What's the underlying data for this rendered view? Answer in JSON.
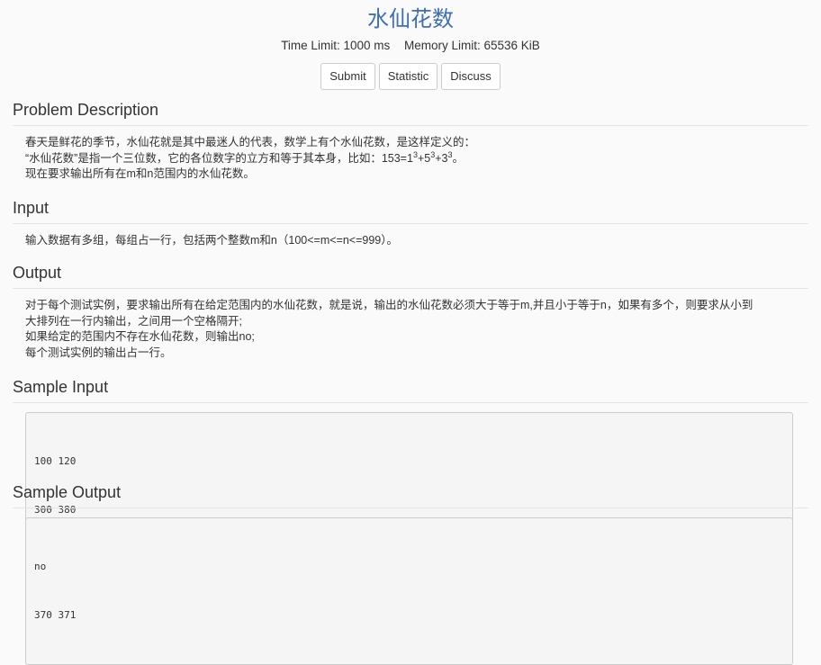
{
  "header": {
    "title": "水仙花数",
    "time_limit": "Time Limit: 1000 ms",
    "memory_limit": "Memory Limit: 65536 KiB",
    "buttons": [
      "Submit",
      "Statistic",
      "Discuss"
    ]
  },
  "description": {
    "title": "Problem Description",
    "line1": "春天是鲜花的季节，水仙花就是其中最迷人的代表，数学上有个水仙花数，是这样定义的：",
    "line2_text": "“水仙花数”是指一个三位数，它的各位数字的立方和等于其本身，比如：",
    "formula": {
      "prefix": "153=1",
      "exp1": "3",
      "plus1": "+5",
      "exp2": "3",
      "plus2": "+3",
      "exp3": "3",
      "end": "。"
    },
    "line3": "现在要求输出所有在m和n范围内的水仙花数。"
  },
  "input": {
    "title": "Input",
    "line1": "输入数据有多组，每组占一行，包括两个整数m和n（100<=m<=n<=999）。"
  },
  "output": {
    "title": "Output",
    "line1": "对于每个测试实例，要求输出所有在给定范围内的水仙花数，就是说，输出的水仙花数必须大于等于m,并且小于等于n，如果有多个，则要求从小到",
    "line2": "大排列在一行内输出，之间用一个空格隔开;",
    "line3": "如果给定的范围内不存在水仙花数，则输出no;",
    "line4": "每个测试实例的输出占一行。"
  },
  "sample_input": {
    "title": "Sample Input",
    "lines": [
      "100 120",
      "300 380"
    ]
  },
  "sample_output": {
    "title": "Sample Output",
    "lines": [
      "no",
      "370 371"
    ]
  }
}
